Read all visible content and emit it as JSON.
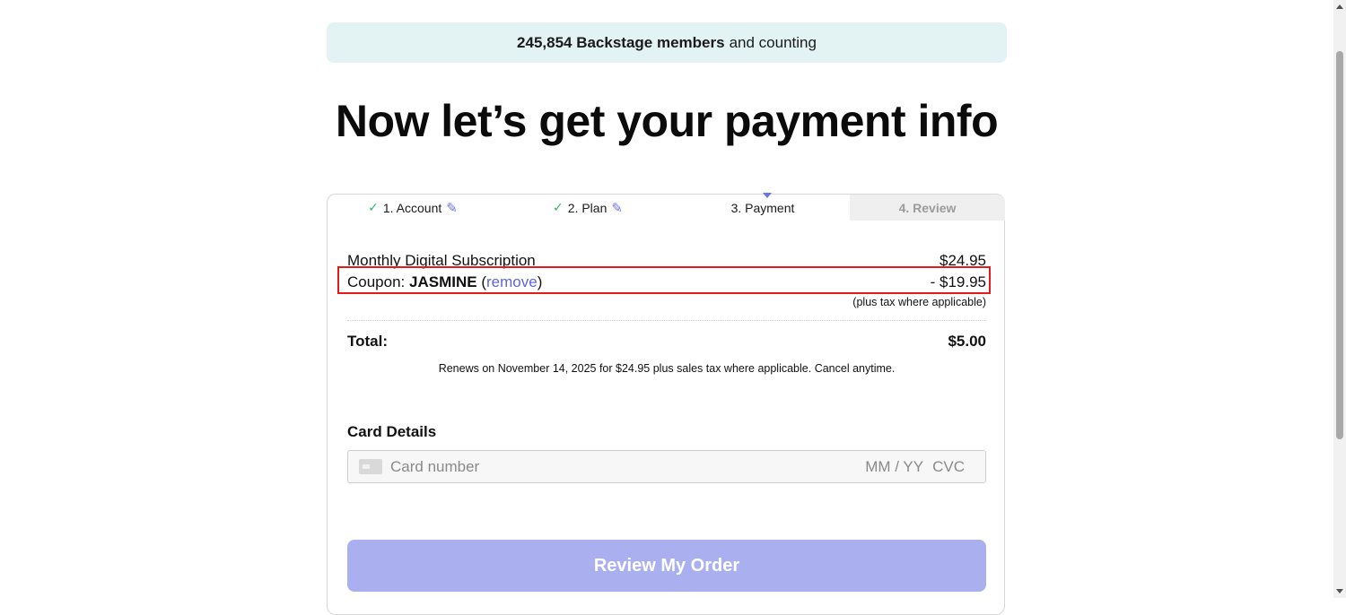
{
  "banner": {
    "count_bold": "245,854 Backstage members",
    "suffix": "and counting"
  },
  "headline": "Now let’s get your payment info",
  "steps": [
    {
      "label": "1. Account",
      "state": "done"
    },
    {
      "label": "2. Plan",
      "state": "done"
    },
    {
      "label": "3. Payment",
      "state": "active"
    },
    {
      "label": "4. Review",
      "state": "upcoming"
    }
  ],
  "icons": {
    "check": "check-icon",
    "edit": "pencil-icon",
    "card": "credit-card-icon"
  },
  "order": {
    "subscription_label": "Monthly Digital Subscription",
    "subscription_price": "$24.95",
    "coupon_prefix": "Coupon:",
    "coupon_code": "JASMINE",
    "coupon_remove": "remove",
    "coupon_discount": "- $19.95",
    "tax_note": "(plus tax where applicable)",
    "total_label": "Total:",
    "total_value": "$5.00",
    "renew_note": "Renews on November 14, 2025 for $24.95 plus sales tax where applicable. Cancel anytime."
  },
  "card_details": {
    "title": "Card Details",
    "number_placeholder": "Card number",
    "expiry_placeholder": "MM / YY",
    "cvc_placeholder": "CVC"
  },
  "submit": {
    "label": "Review My Order"
  },
  "colors": {
    "accent": "#6b74e6",
    "button_disabled": "#aab0ef",
    "banner_bg": "#e3f3f3",
    "highlight": "#e41b1b",
    "check": "#2bb673"
  }
}
